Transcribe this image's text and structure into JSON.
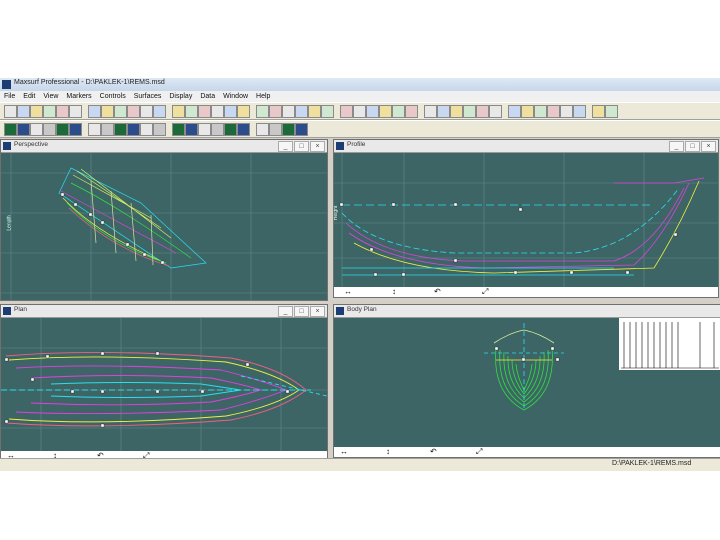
{
  "app": {
    "title": "Maxsurf Professional - D:\\PAKLEK-1\\REMS.msd"
  },
  "menu": [
    "File",
    "Edit",
    "View",
    "Markers",
    "Controls",
    "Surfaces",
    "Display",
    "Data",
    "Window",
    "Help"
  ],
  "views": {
    "perspective": {
      "title": "Perspective",
      "axis_label": "Length"
    },
    "profile": {
      "title": "Profile",
      "axis_label": "Height"
    },
    "plan": {
      "title": "Plan"
    },
    "body_plan": {
      "title": "Body Plan"
    }
  },
  "window_buttons": {
    "min": "_",
    "max": "□",
    "close": "×"
  },
  "view_tools": {
    "pan": "↔",
    "zoom": "↕",
    "rotate": "↶",
    "fit": "⤢"
  },
  "status": {
    "path": "D:\\PAKLEK-1\\REMS.msd"
  },
  "colors": {
    "viewport": "#3e6565",
    "grid": "#5e8a8a",
    "cyan": "#26e0f0",
    "magenta": "#e040e0",
    "yellow": "#f0f040",
    "green": "#30e040",
    "pink": "#f06080",
    "white": "#ffffff"
  }
}
